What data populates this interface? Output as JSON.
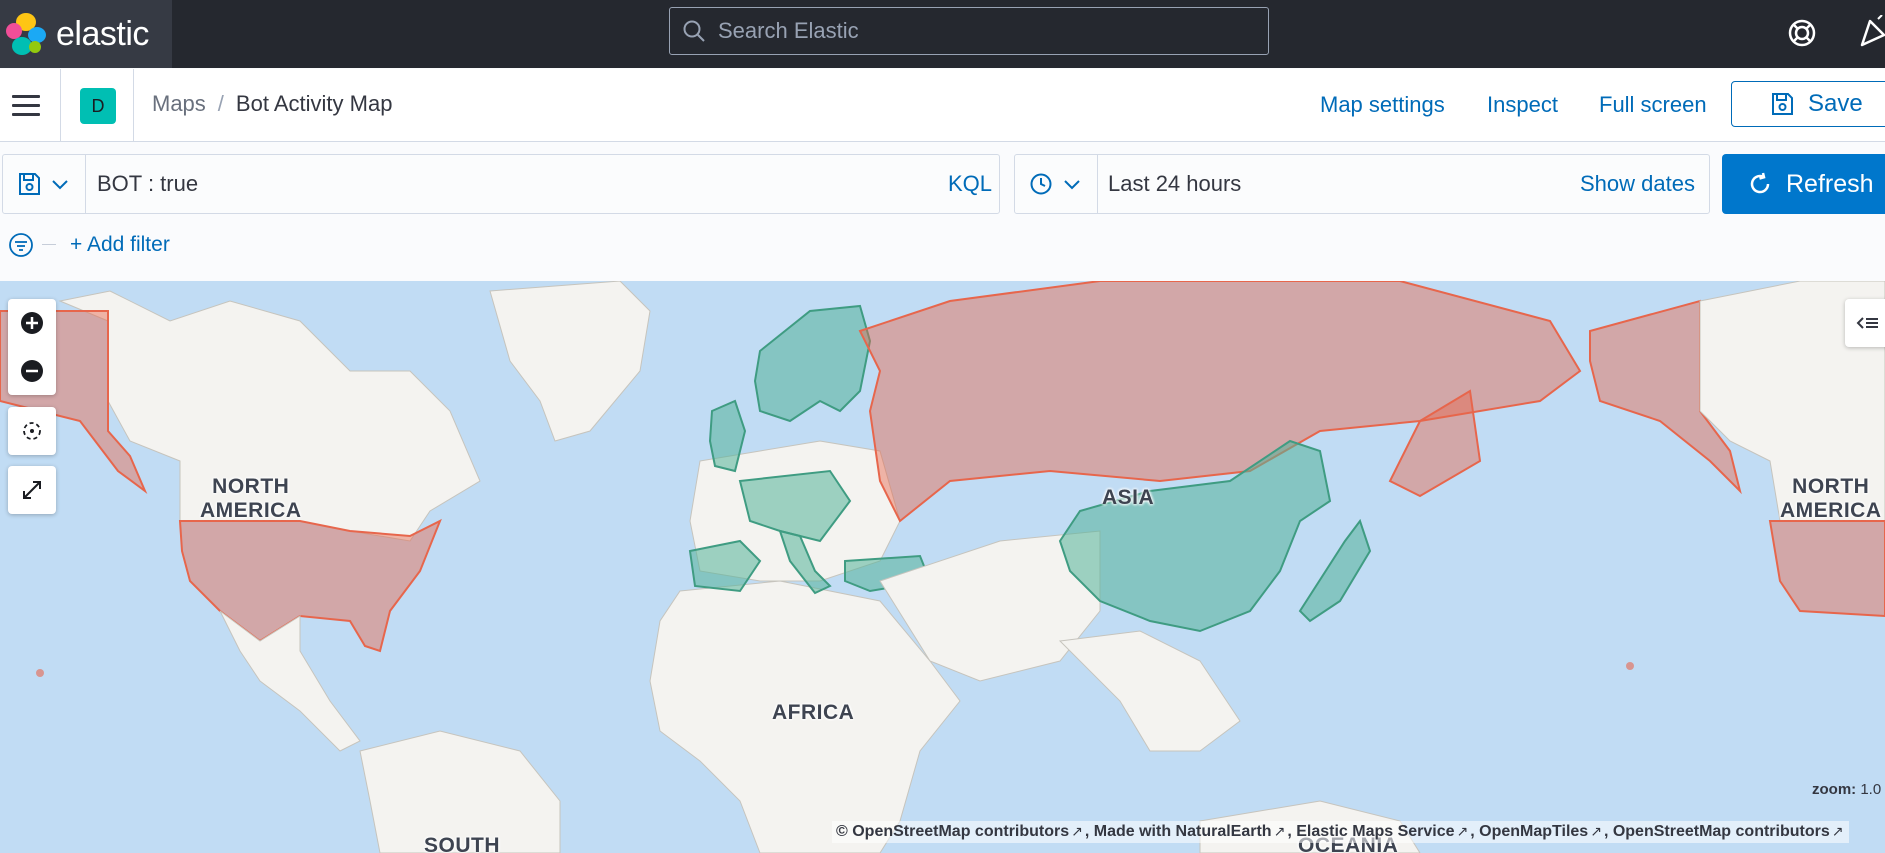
{
  "header": {
    "brand": "elastic",
    "search": {
      "placeholder": "Search Elastic",
      "value": ""
    },
    "icons": [
      "help-icon",
      "newsfeed-icon"
    ]
  },
  "subheader": {
    "space_initial": "D",
    "breadcrumbs": [
      {
        "label": "Maps"
      },
      {
        "label": "Bot Activity Map"
      }
    ],
    "actions": {
      "map_settings": "Map settings",
      "inspect": "Inspect",
      "full_screen": "Full screen",
      "save": "Save"
    }
  },
  "query_bar": {
    "query": "BOT : true",
    "language": "KQL",
    "time_range": "Last 24 hours",
    "show_dates": "Show dates",
    "refresh": "Refresh"
  },
  "filter_bar": {
    "add_filter": "+ Add filter"
  },
  "map": {
    "continent_labels": {
      "north_america": "NORTH\nAMERICA",
      "north_america_repeat": "NORTH\nAMERICA",
      "asia": "ASIA",
      "africa": "AFRICA",
      "south_america": "SOUTH",
      "oceania": "OCEANIA"
    },
    "zoom_label": "zoom:",
    "zoom_value": "1.0",
    "attribution": [
      "© OpenStreetMap contributors",
      "Made with NaturalEarth",
      "Elastic Maps Service",
      "OpenMapTiles",
      "OpenStreetMap contributors"
    ],
    "fill_colors": {
      "bot_true": "#e7664c",
      "bot_false": "#54b399",
      "ocean": "#c1dcf4",
      "land": "#f4f3f0"
    }
  }
}
